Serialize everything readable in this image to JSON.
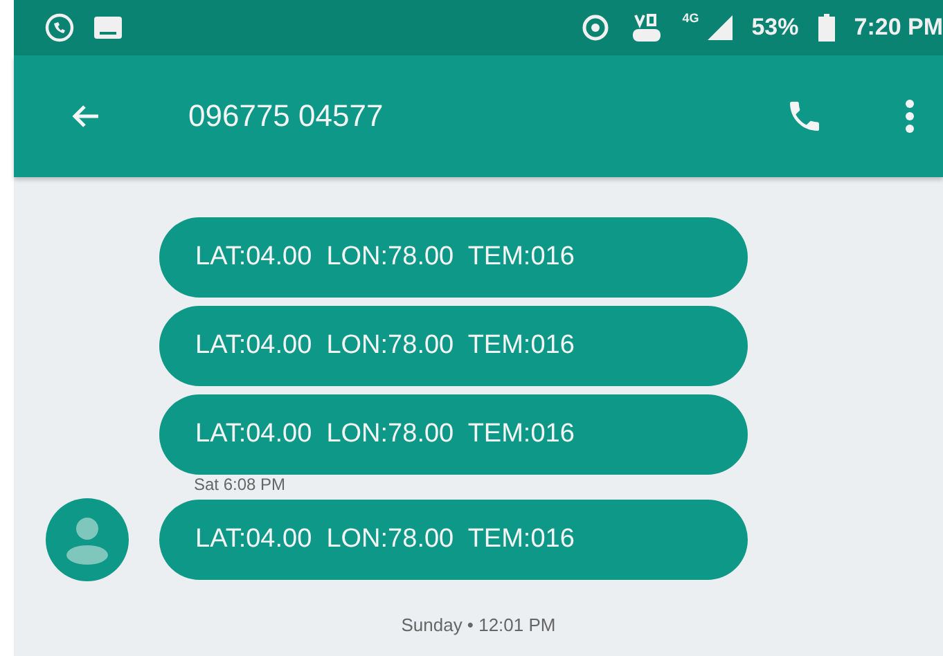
{
  "status_bar": {
    "network": "4G",
    "battery": "53%",
    "time": "7:20 PM"
  },
  "header": {
    "title": "096775 04577"
  },
  "thread": [
    {
      "kind": "message",
      "text": "LAT:04.00  LON:78.00  TEM:016",
      "avatar": false
    },
    {
      "kind": "message",
      "text": "LAT:04.00  LON:78.00  TEM:016",
      "avatar": false
    },
    {
      "kind": "message",
      "text": "LAT:04.00  LON:78.00  TEM:016",
      "avatar": false
    },
    {
      "kind": "timestamp",
      "text": "Sat 6:08 PM"
    },
    {
      "kind": "message",
      "text": "LAT:04.00  LON:78.00  TEM:016",
      "avatar": true
    },
    {
      "kind": "divider",
      "text": "Sunday • 12:01 PM"
    }
  ]
}
